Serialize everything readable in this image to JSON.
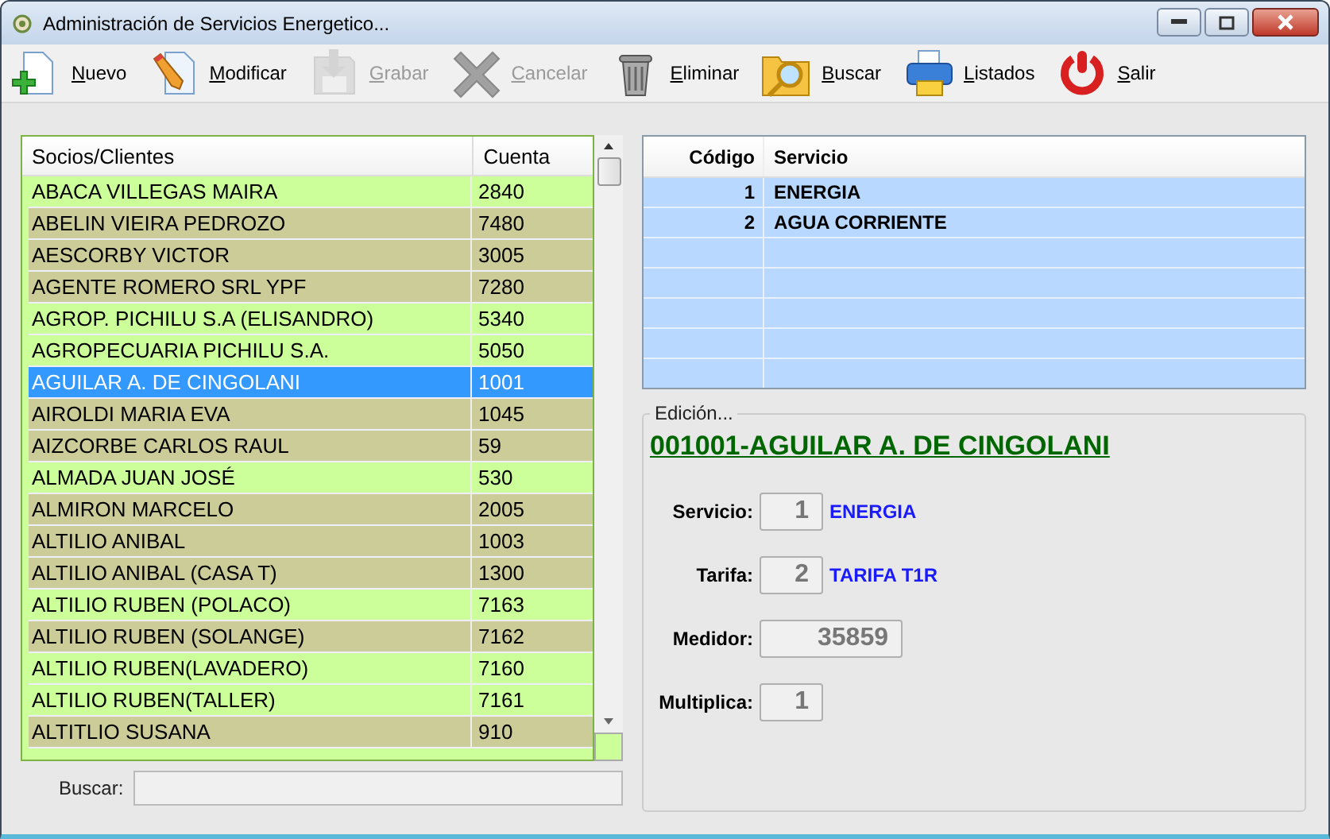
{
  "window": {
    "title": "Administración de Servicios Energetico..."
  },
  "toolbar": [
    {
      "kind": "new",
      "label": "Nuevo",
      "mnemonic": true,
      "disabled": false
    },
    {
      "kind": "edit",
      "label": "Modificar",
      "mnemonic": true,
      "disabled": false
    },
    {
      "kind": "save",
      "label": "Grabar",
      "mnemonic": true,
      "disabled": true
    },
    {
      "kind": "cancel",
      "label": "Cancelar",
      "mnemonic": true,
      "disabled": true
    },
    {
      "kind": "delete",
      "label": "Eliminar",
      "mnemonic": true,
      "disabled": false
    },
    {
      "kind": "search",
      "label": "Buscar",
      "mnemonic": true,
      "disabled": false
    },
    {
      "kind": "print",
      "label": "Listados",
      "mnemonic": true,
      "disabled": false
    },
    {
      "kind": "exit",
      "label": "Salir",
      "mnemonic": true,
      "disabled": false
    }
  ],
  "clients_table": {
    "columns": [
      "Socios/Clientes",
      "Cuenta"
    ],
    "rows": [
      {
        "name": "ABACA VILLEGAS MAIRA",
        "account": "2840",
        "color": "#ccff99",
        "selected": false
      },
      {
        "name": "ABELIN VIEIRA PEDROZO",
        "account": "7480",
        "color": "#cccc99",
        "selected": false
      },
      {
        "name": "AESCORBY VICTOR",
        "account": "3005",
        "color": "#cccc99",
        "selected": false
      },
      {
        "name": "AGENTE ROMERO SRL YPF",
        "account": "7280",
        "color": "#cccc99",
        "selected": false
      },
      {
        "name": "AGROP. PICHILU S.A (ELISANDRO)",
        "account": "5340",
        "color": "#ccff99",
        "selected": false
      },
      {
        "name": "AGROPECUARIA PICHILU S.A.",
        "account": "5050",
        "color": "#ccff99",
        "selected": false
      },
      {
        "name": "AGUILAR A. DE CINGOLANI",
        "account": "1001",
        "selected": true
      },
      {
        "name": "AIROLDI MARIA EVA",
        "account": "1045",
        "color": "#cccc99",
        "selected": false
      },
      {
        "name": "AIZCORBE CARLOS RAUL",
        "account": "59",
        "color": "#cccc99",
        "selected": false
      },
      {
        "name": "ALMADA JUAN JOSÉ",
        "account": "530",
        "color": "#ccff99",
        "selected": false
      },
      {
        "name": "ALMIRON MARCELO",
        "account": "2005",
        "color": "#cccc99",
        "selected": false
      },
      {
        "name": "ALTILIO ANIBAL",
        "account": "1003",
        "color": "#cccc99",
        "selected": false
      },
      {
        "name": "ALTILIO ANIBAL (CASA T)",
        "account": "1300",
        "color": "#cccc99",
        "selected": false
      },
      {
        "name": "ALTILIO RUBEN (POLACO)",
        "account": "7163",
        "color": "#ccff99",
        "selected": false
      },
      {
        "name": "ALTILIO RUBEN (SOLANGE)",
        "account": "7162",
        "color": "#cccc99",
        "selected": false
      },
      {
        "name": "ALTILIO RUBEN(LAVADERO)",
        "account": "7160",
        "color": "#ccff99",
        "selected": false
      },
      {
        "name": "ALTILIO RUBEN(TALLER)",
        "account": "7161",
        "color": "#ccff99",
        "selected": false
      },
      {
        "name": "ALTITLIO SUSANA",
        "account": "910",
        "color": "#cccc99",
        "selected": false
      }
    ]
  },
  "search": {
    "label": "Buscar:"
  },
  "services_table": {
    "columns": [
      "Código",
      "Servicio"
    ],
    "rows": [
      {
        "code": "1",
        "service": "ENERGIA"
      },
      {
        "code": "2",
        "service": "AGUA CORRIENTE"
      }
    ]
  },
  "edit_group": {
    "legend": "Edición...",
    "heading": "001001-AGUILAR A. DE CINGOLANI",
    "fields": [
      {
        "kind": "short",
        "label": "Servicio:",
        "value": "1",
        "description": "ENERGIA"
      },
      {
        "kind": "short",
        "label": "Tarifa:",
        "value": "2",
        "description": "TARIFA T1R"
      },
      {
        "kind": "long",
        "label": "Medidor:",
        "value": "35859"
      },
      {
        "kind": "short",
        "label": "Multiplica:",
        "value": "1"
      }
    ]
  }
}
